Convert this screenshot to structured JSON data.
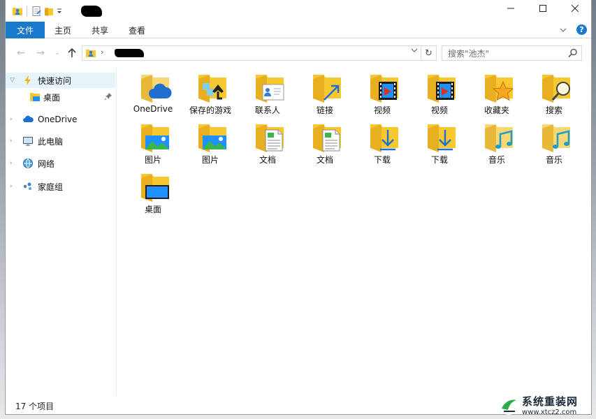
{
  "ribbon": {
    "file_tab": "文件",
    "tabs": [
      "主页",
      "共享",
      "查看"
    ]
  },
  "search": {
    "placeholder": "搜索\"池杰\""
  },
  "sidebar": {
    "items": [
      {
        "label": "快速访问",
        "icon": "star-icon"
      },
      {
        "label": "桌面",
        "icon": "desktop-icon"
      },
      {
        "label": "OneDrive",
        "icon": "cloud-icon"
      },
      {
        "label": "此电脑",
        "icon": "computer-icon"
      },
      {
        "label": "网络",
        "icon": "network-icon"
      },
      {
        "label": "家庭组",
        "icon": "homegroup-icon"
      }
    ]
  },
  "items": [
    {
      "label": "OneDrive",
      "icon": "onedrive-folder-icon"
    },
    {
      "label": "保存的游戏",
      "icon": "saved-games-folder-icon"
    },
    {
      "label": "联系人",
      "icon": "contacts-folder-icon"
    },
    {
      "label": "链接",
      "icon": "links-folder-icon"
    },
    {
      "label": "视频",
      "icon": "videos-folder-icon"
    },
    {
      "label": "视频",
      "icon": "videos-folder-icon"
    },
    {
      "label": "收藏夹",
      "icon": "favorites-folder-icon"
    },
    {
      "label": "搜索",
      "icon": "searches-folder-icon"
    },
    {
      "label": "图片",
      "icon": "pictures-folder-icon"
    },
    {
      "label": "图片",
      "icon": "pictures-folder-icon"
    },
    {
      "label": "文档",
      "icon": "documents-folder-icon"
    },
    {
      "label": "文档",
      "icon": "documents-folder-icon"
    },
    {
      "label": "下载",
      "icon": "downloads-folder-icon"
    },
    {
      "label": "下载",
      "icon": "downloads-folder-icon"
    },
    {
      "label": "音乐",
      "icon": "music-folder-icon"
    },
    {
      "label": "音乐",
      "icon": "music-folder-icon"
    },
    {
      "label": "桌面",
      "icon": "desktop-folder-icon"
    }
  ],
  "status": {
    "count_text": "17 个项目"
  },
  "watermark": {
    "main": "系统重装网",
    "sub": "www.xtcz2.com"
  },
  "colors": {
    "accent": "#1979ca",
    "folder": "#f8c830",
    "selected": "#e5f3fb"
  }
}
